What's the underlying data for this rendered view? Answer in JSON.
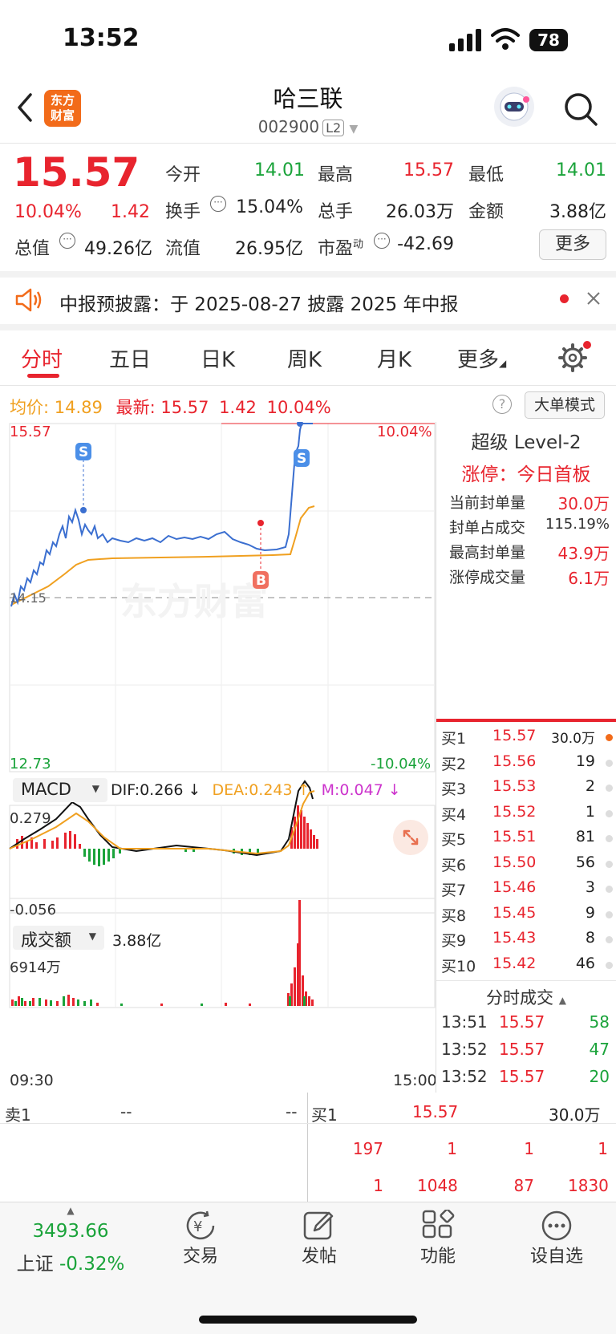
{
  "status": {
    "time": "13:52",
    "battery": "78"
  },
  "nav": {
    "title": "哈三联",
    "code": "002900",
    "level": "L2",
    "logo": "东方财富"
  },
  "quote": {
    "price": "15.57",
    "pct": "10.04%",
    "change": "1.42",
    "open_label": "今开",
    "open": "14.01",
    "high_label": "最高",
    "high": "15.57",
    "low_label": "最低",
    "low": "14.01",
    "turnover_label": "换手",
    "turnover": "15.04%",
    "volume_label": "总手",
    "volume": "26.03万",
    "amount_label": "金额",
    "amount": "3.88亿",
    "mktcap_label": "总值",
    "mktcap": "49.26亿",
    "float_label": "流值",
    "float_cap": "26.95亿",
    "pe_label": "市盈",
    "pe_sup": "动",
    "pe": "-42.69",
    "more_button": "更多"
  },
  "notice": {
    "text": "中报预披露：于 2025-08-27 披露 2025 年中报"
  },
  "tabs": [
    "分时",
    "五日",
    "日K",
    "周K",
    "月K",
    "更多"
  ],
  "avgline": {
    "avg_label": "均价:",
    "avg": "14.89",
    "latest_label": "最新:",
    "latest": "15.57",
    "chg": "1.42",
    "pct": "10.04%",
    "mode_button": "大单模式"
  },
  "chart": {
    "price_top": "15.57",
    "pct_top": "10.04%",
    "price_mid": "14.15",
    "price_bottom": "12.73",
    "pct_bottom": "-10.04%",
    "watermark": "东方财富",
    "time_start": "09:30",
    "time_end": "15:00"
  },
  "macd": {
    "name": "MACD",
    "dif": "DIF:0.266 ↓",
    "dea": "DEA:0.243 ↑",
    "m": "M:0.047 ↓",
    "top": "0.279",
    "bottom": "-0.056"
  },
  "volume": {
    "name": "成交额",
    "value": "3.88亿",
    "max": "6914万"
  },
  "level2": {
    "title": "超级 Level-2",
    "limit_label": "涨停：今日首板",
    "rows": [
      {
        "label": "当前封单量",
        "value": "30.0万"
      },
      {
        "label": "封单占成交",
        "value": "115.19%"
      },
      {
        "label": "最高封单量",
        "value": "43.9万"
      },
      {
        "label": "涨停成交量",
        "value": "6.1万"
      }
    ]
  },
  "bids": [
    {
      "label": "买1",
      "price": "15.57",
      "vol": "30.0万"
    },
    {
      "label": "买2",
      "price": "15.56",
      "vol": "19"
    },
    {
      "label": "买3",
      "price": "15.53",
      "vol": "2"
    },
    {
      "label": "买4",
      "price": "15.52",
      "vol": "1"
    },
    {
      "label": "买5",
      "price": "15.51",
      "vol": "81"
    },
    {
      "label": "买6",
      "price": "15.50",
      "vol": "56"
    },
    {
      "label": "买7",
      "price": "15.46",
      "vol": "3"
    },
    {
      "label": "买8",
      "price": "15.45",
      "vol": "9"
    },
    {
      "label": "买9",
      "price": "15.43",
      "vol": "8"
    },
    {
      "label": "买10",
      "price": "15.42",
      "vol": "46"
    }
  ],
  "ticks": {
    "title": "分时成交",
    "rows": [
      {
        "time": "13:51",
        "price": "15.57",
        "vol": "58"
      },
      {
        "time": "13:52",
        "price": "15.57",
        "vol": "47"
      },
      {
        "time": "13:52",
        "price": "15.57",
        "vol": "20"
      }
    ]
  },
  "queue": {
    "sell_label": "卖1",
    "sell_price": "--",
    "sell_vol": "--",
    "buy_label": "买1",
    "buy_price": "15.57",
    "buy_vol": "30.0万",
    "row1": [
      "197",
      "1",
      "1",
      "1"
    ],
    "row2": [
      "1",
      "1048",
      "87",
      "1830"
    ]
  },
  "bottom": {
    "index_value": "3493.66",
    "index_name": "上证",
    "index_pct": "-0.32%",
    "trade": "交易",
    "post": "发帖",
    "func": "功能",
    "fav": "设自选"
  },
  "colors": {
    "up": "#e8242e",
    "down": "#1aa33a",
    "avg": "#f0a020",
    "price": "#3b6fd0"
  }
}
